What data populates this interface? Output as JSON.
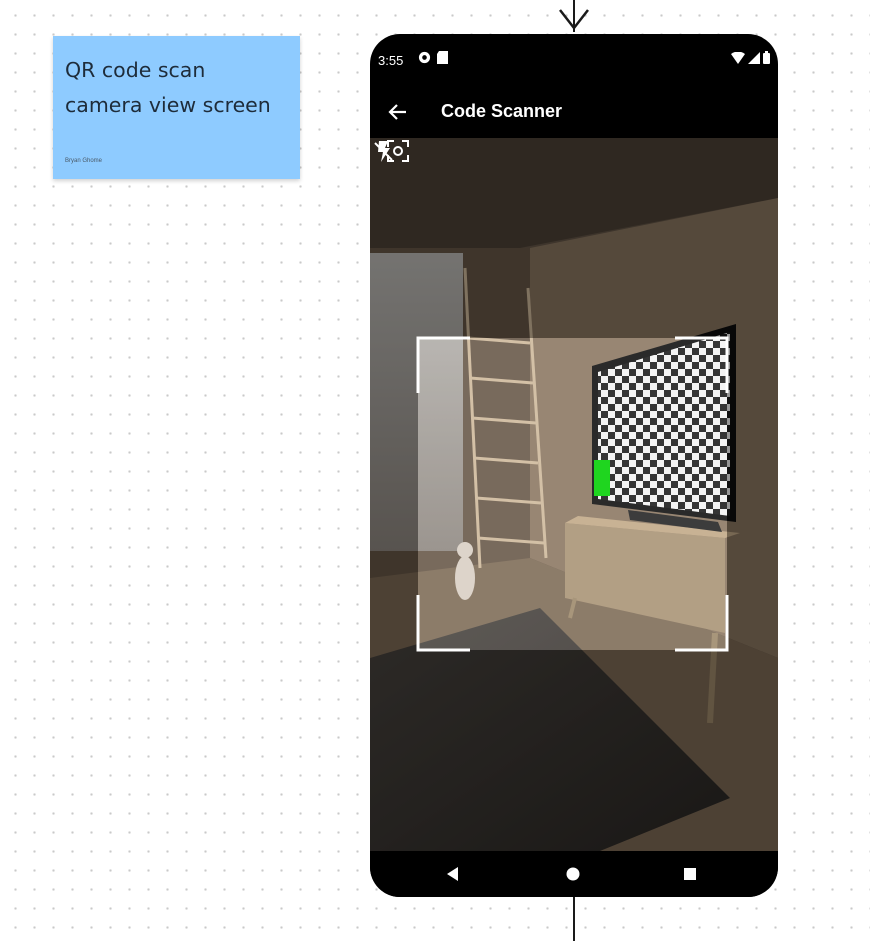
{
  "sticky_note": {
    "title_line1": "QR code scan",
    "title_line2": "camera view screen",
    "author": "Bryan Ghome"
  },
  "status_bar": {
    "time": "3:55",
    "left_icons": [
      "settings-icon",
      "sim-card-icon"
    ],
    "right_icons": [
      "wifi-icon",
      "cellular-signal-icon",
      "battery-icon"
    ]
  },
  "app_bar": {
    "title": "Code Scanner",
    "back_icon": "arrow-back-icon"
  },
  "camera_controls": {
    "left": "focus-scan-icon",
    "right": "flash-off-icon"
  },
  "nav_bar": {
    "buttons": [
      "back-triangle-icon",
      "home-circle-icon",
      "recents-square-icon"
    ]
  },
  "colors": {
    "sticky_bg": "#8ecbff",
    "phone_frame": "#000000",
    "scan_frame": "#ffffff",
    "qr_marker": "#00d000"
  }
}
